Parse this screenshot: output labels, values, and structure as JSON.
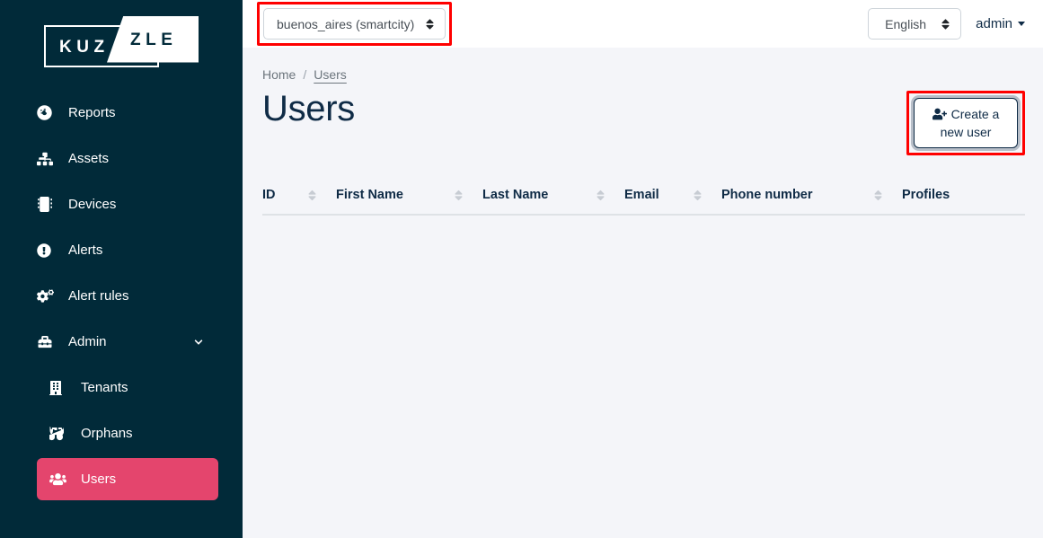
{
  "brand": {
    "logo_part1": "KUZ",
    "logo_part2": "ZLE",
    "logo_name": "KUZZLE"
  },
  "colors": {
    "sidebar_bg": "#012a39",
    "active_item": "#e4456d",
    "content_bg": "#f4f5f9",
    "title_color": "#0f2b46",
    "highlight_red": "#ff0000"
  },
  "sidebar": {
    "items": [
      {
        "label": "Reports",
        "icon": "tachometer-icon",
        "active": false,
        "sub": false,
        "chevron": false
      },
      {
        "label": "Assets",
        "icon": "sitemap-icon",
        "active": false,
        "sub": false,
        "chevron": false
      },
      {
        "label": "Devices",
        "icon": "microchip-icon",
        "active": false,
        "sub": false,
        "chevron": false
      },
      {
        "label": "Alerts",
        "icon": "exclamation-circle-icon",
        "active": false,
        "sub": false,
        "chevron": false
      },
      {
        "label": "Alert rules",
        "icon": "cogs-icon",
        "active": false,
        "sub": false,
        "chevron": false
      },
      {
        "label": "Admin",
        "icon": "toolbox-icon",
        "active": false,
        "sub": false,
        "chevron": true
      },
      {
        "label": "Tenants",
        "icon": "building-icon",
        "active": false,
        "sub": true,
        "chevron": false
      },
      {
        "label": "Orphans",
        "icon": "binoculars-icon",
        "active": false,
        "sub": true,
        "chevron": false
      },
      {
        "label": "Users",
        "icon": "users-icon",
        "active": true,
        "sub": true,
        "chevron": false
      }
    ]
  },
  "topbar": {
    "tenant_select": {
      "value": "buenos_aires (smartcity)",
      "highlighted": true
    },
    "language_select": {
      "value": "English"
    },
    "account_menu": {
      "label": "admin"
    }
  },
  "breadcrumb": {
    "home": "Home",
    "separator": "/",
    "current": "Users"
  },
  "page": {
    "title": "Users"
  },
  "actions": {
    "create_user": {
      "line1": "Create a",
      "line2": "new user",
      "icon": "user-plus-icon",
      "highlighted": true
    }
  },
  "table": {
    "columns": [
      {
        "label": "ID",
        "sortable": true
      },
      {
        "label": "First Name",
        "sortable": true
      },
      {
        "label": "Last Name",
        "sortable": true
      },
      {
        "label": "Email",
        "sortable": true
      },
      {
        "label": "Phone number",
        "sortable": true
      },
      {
        "label": "Profiles",
        "sortable": false
      }
    ],
    "rows": []
  }
}
